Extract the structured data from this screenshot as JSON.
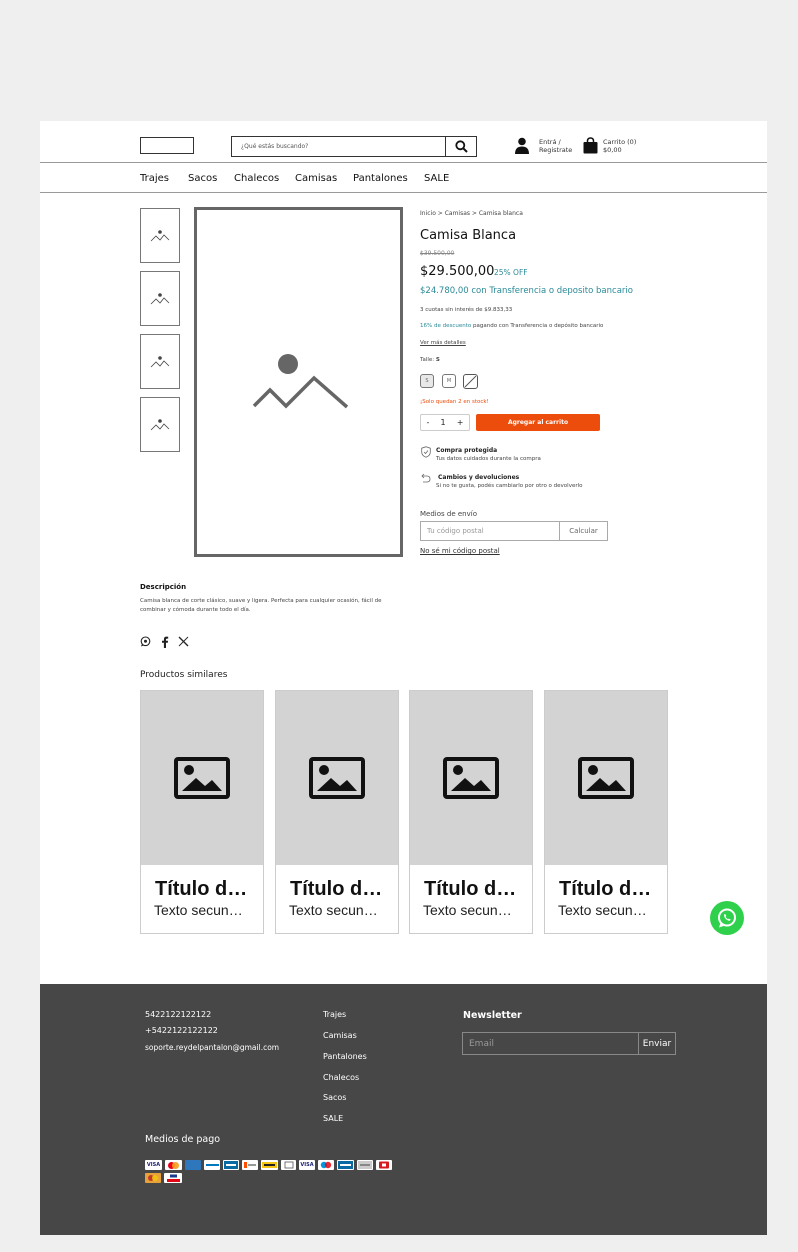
{
  "header": {
    "search_placeholder": "¿Qué estás buscando?",
    "account_line1": "Entrá /",
    "account_line2": "Registrate",
    "cart_line1": "Carrito (0)",
    "cart_line2": "$0,00"
  },
  "nav": {
    "items": [
      "Trajes",
      "Sacos",
      "Chalecos",
      "Camisas",
      "Pantalones",
      "SALE"
    ]
  },
  "product": {
    "breadcrumb": "Inicio > Camisas > Camisa blanca",
    "title": "Camisa Blanca",
    "old_price": "$39.500,00",
    "price": "$29.500,00",
    "discount_badge": "25% OFF",
    "transfer_price": "$24.780,00 con Transferencia o deposito bancario",
    "installments": "3 cuotas sin interés de $9.833,33",
    "transfer_discount_highlight": "16% de descuento",
    "transfer_discount_rest": " pagando con Transferencia o depósito bancario",
    "details_link": "Ver más detalles",
    "size_label": "Talle: ",
    "size_selected": "S",
    "sizes": [
      "S",
      "M"
    ],
    "stock_warning": "¡Solo quedan 2 en stock!",
    "quantity": "1",
    "qty_minus": "-",
    "qty_plus": "+",
    "add_to_cart": "Agregar al carrito",
    "protected_title": "Compra protegida",
    "protected_text": "Tus datos cuidados durante la compra",
    "returns_title": "Cambios y devoluciones",
    "returns_text": "Si no te gusta, podés cambiarlo por otro o devolverlo",
    "shipping_label": "Medios de envío",
    "zip_placeholder": "Tu código postal",
    "zip_button": "Calcular",
    "zip_help": "No sé mi código postal",
    "description_title": "Descripción",
    "description_text": "Camisa blanca de corte clásico, suave y ligera. Perfecta para cualquier ocasión, fácil de combinar y cómoda durante todo el día."
  },
  "similar": {
    "title": "Productos similares",
    "cards": [
      {
        "title": "Título del producto",
        "subtitle": "Texto secundario"
      },
      {
        "title": "Título del producto",
        "subtitle": "Texto secundario"
      },
      {
        "title": "Título del producto",
        "subtitle": "Texto secundario"
      },
      {
        "title": "Título del producto",
        "subtitle": "Texto secundario"
      }
    ]
  },
  "footer": {
    "phone1": "5422122122122",
    "phone2": "+5422122122122",
    "email": "soporte.reydelpantalon@gmail.com",
    "links": [
      "Trajes",
      "Camisas",
      "Pantalones",
      "Chalecos",
      "Sacos",
      "SALE"
    ],
    "newsletter_title": "Newsletter",
    "newsletter_placeholder": "Email",
    "newsletter_button": "Enviar",
    "payment_title": "Medios de pago"
  },
  "colors": {
    "accent": "#ec4d0c",
    "teal": "#2a8a97",
    "footer_bg": "#474747",
    "whatsapp": "#2fd14c"
  }
}
